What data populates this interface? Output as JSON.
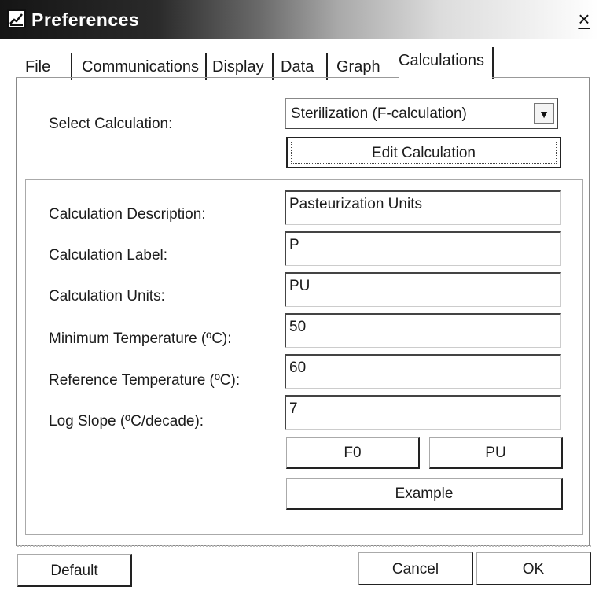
{
  "window": {
    "title": "Preferences",
    "close_glyph": "×"
  },
  "tabs": [
    "File",
    "Communications",
    "Display",
    "Data",
    "Graph",
    "Calculations"
  ],
  "active_tab": "Calculations",
  "select_calculation": {
    "label": "Select Calculation:",
    "value": "Sterilization (F-calculation)",
    "arrow_glyph": "▼"
  },
  "edit_button": "Edit Calculation",
  "fields": [
    {
      "label": "Calculation Description:",
      "value": "Pasteurization Units"
    },
    {
      "label": "Calculation Label:",
      "value": "P"
    },
    {
      "label": "Calculation Units:",
      "value": "PU"
    },
    {
      "label": "Minimum Temperature (ºC):",
      "value": "50"
    },
    {
      "label": "Reference Temperature (ºC):",
      "value": "60"
    },
    {
      "label": "Log Slope (ºC/decade):",
      "value": "7"
    }
  ],
  "preset_buttons": {
    "f0": "F0",
    "pu": "PU",
    "example": "Example"
  },
  "footer": {
    "default": "Default",
    "cancel": "Cancel",
    "ok": "OK"
  },
  "icons": {
    "window_icon": "preferences-app-icon",
    "close_icon": "close-icon",
    "dropdown_icon": "chevron-down-icon"
  }
}
